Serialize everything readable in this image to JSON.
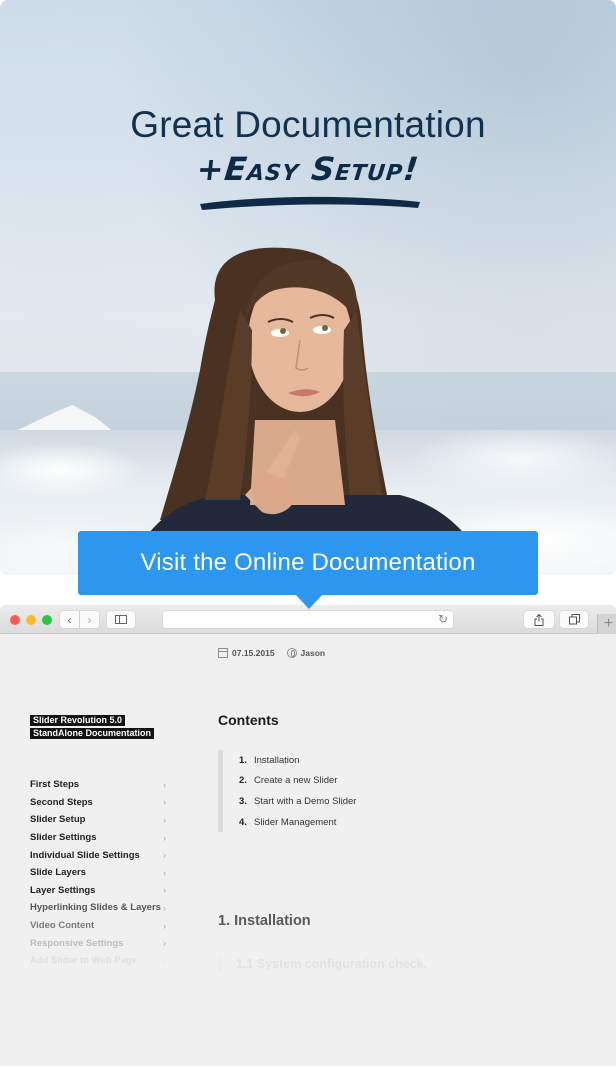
{
  "hero": {
    "title": "Great Documentation",
    "subtitle": "+Easy Setup!",
    "title_color": "#13304d"
  },
  "cta": {
    "label": "Visit the Online Documentation",
    "color": "#2d96ee"
  },
  "browser": {
    "toolbar": {
      "traffic_lights": [
        "close",
        "minimize",
        "zoom"
      ],
      "back_icon": "‹",
      "forward_icon": "›",
      "sidebar_icon": "sidebar-icon",
      "address_value": "",
      "reload_icon": "↻",
      "share_icon": "⇪",
      "tabs_icon": "⧉",
      "new_tab_icon": "+"
    },
    "meta": {
      "date": "07.15.2015",
      "author": "Jason"
    },
    "sidebar": {
      "product_line1": "Slider Revolution 5.0",
      "product_line2": "StandAlone Documentation",
      "chevron": "›",
      "items": [
        {
          "label": "First Steps"
        },
        {
          "label": "Second Steps"
        },
        {
          "label": "Slider Setup"
        },
        {
          "label": "Slider Settings"
        },
        {
          "label": "Individual Slide Settings"
        },
        {
          "label": "Slide Layers"
        },
        {
          "label": "Layer Settings"
        },
        {
          "label": "Hyperlinking Slides & Layers"
        },
        {
          "label": "Video Content"
        },
        {
          "label": "Responsive Settings"
        },
        {
          "label": "Add Slider to Web Page"
        }
      ]
    },
    "content": {
      "contents_title": "Contents",
      "toc": [
        {
          "num": "1.",
          "label": "Installation"
        },
        {
          "num": "2.",
          "label": "Create a new Slider"
        },
        {
          "num": "3.",
          "label": "Start with a Demo Slider"
        },
        {
          "num": "4.",
          "label": "Slider Management"
        }
      ],
      "section_title": "1. Installation",
      "subsection_title": "1.1 System configuration check."
    }
  }
}
